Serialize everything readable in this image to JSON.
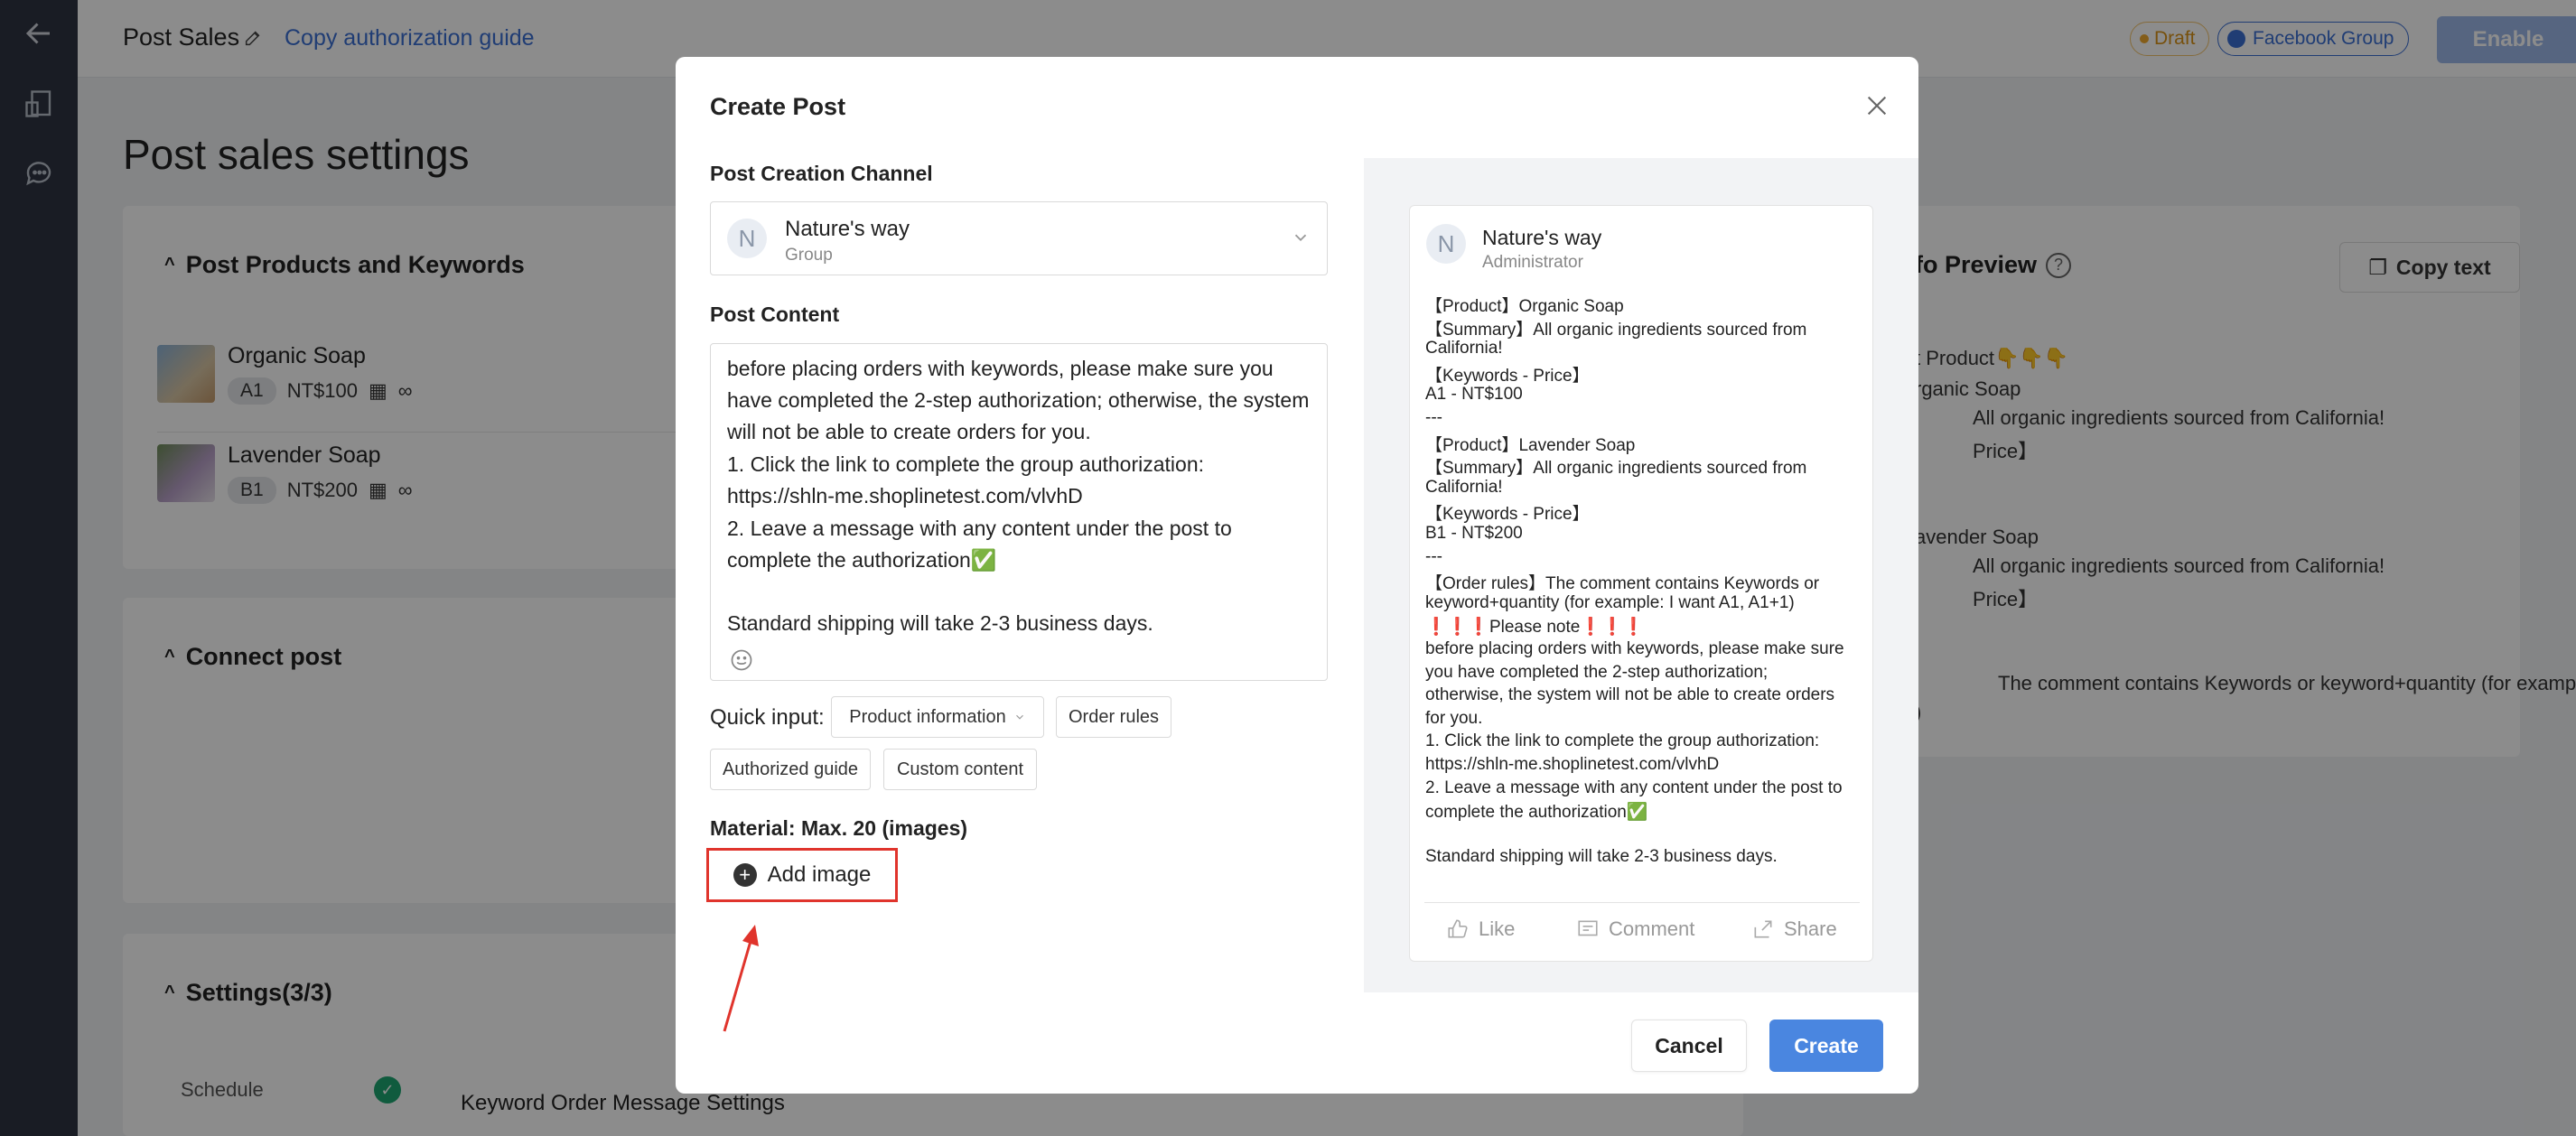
{
  "topbar": {
    "title": "Post Sales",
    "copy_guide_link": "Copy authorization guide",
    "draft_badge": "Draft",
    "channel_badge": "Facebook Group",
    "enable_button": "Enable"
  },
  "background": {
    "page_heading": "Post sales settings",
    "products_section": {
      "title": "Post Products and Keywords",
      "products": [
        {
          "name": "Organic Soap",
          "keyword": "A1",
          "price": "NT$100",
          "stock": "∞"
        },
        {
          "name": "Lavender Soap",
          "keyword": "B1",
          "price": "NT$200",
          "stock": "∞"
        }
      ]
    },
    "connect_section": {
      "title": "Connect post"
    },
    "settings_section": {
      "title": "Settings(3/3)",
      "schedule_tab": "Schedule",
      "keyword_settings": "Keyword Order Message Settings"
    },
    "info_preview": {
      "title_visible": "fo Preview",
      "copy_text_button": "Copy text",
      "lines": [
        "t Product👇👇👇",
        "rganic Soap",
        "All organic ingredients sourced from California!",
        "Price】",
        "avender Soap",
        "All organic ingredients sourced from California!",
        "Price】",
        "The comment contains Keywords or keyword+quantity (for example: I",
        ")"
      ]
    }
  },
  "modal": {
    "title": "Create Post",
    "channel_label": "Post Creation Channel",
    "channel": {
      "avatar_letter": "N",
      "name": "Nature's way",
      "type": "Group"
    },
    "content_label": "Post Content",
    "content_lines": [
      "before placing orders with keywords, please make sure you",
      "have completed the 2-step authorization; otherwise, the system",
      "will not be able to create orders for you.",
      "1. Click the link to complete the group authorization:",
      "https://shln-me.shoplinetest.com/vlvhD",
      "2. Leave a message with any content under the post to",
      "complete the authorization✅",
      "",
      "Standard shipping will take 2-3 business days."
    ],
    "quick_input_label": "Quick input:",
    "quick_buttons": {
      "product_info": "Product information",
      "order_rules": "Order rules",
      "authorized_guide": "Authorized guide",
      "custom_content": "Custom content"
    },
    "material_label": "Material: Max. 20 (images)",
    "add_image": "Add image",
    "cancel": "Cancel",
    "create": "Create",
    "preview": {
      "avatar_letter": "N",
      "name": "Nature's way",
      "role": "Administrator",
      "lines": [
        "【Product】Organic Soap",
        "【Summary】All organic ingredients sourced from",
        "California!",
        "【Keywords - Price】",
        "A1 - NT$100",
        "---",
        "【Product】Lavender Soap",
        "【Summary】All organic ingredients sourced from",
        "California!",
        "【Keywords - Price】",
        "B1 - NT$200",
        "---",
        "【Order rules】The comment contains Keywords or",
        "keyword+quantity (for example: I want A1, A1+1)",
        "❗❗❗Please note❗❗❗",
        "before placing orders with keywords, please make sure",
        "you have completed the 2-step authorization;",
        "otherwise, the system will not be able to create orders",
        "for you.",
        "1. Click the link to complete the group authorization:",
        "https://shln-me.shoplinetest.com/vlvhD",
        "2. Leave a message with any content under the post to",
        "complete the authorization✅",
        "",
        "Standard shipping will take 2-3 business days."
      ],
      "actions": {
        "like": "Like",
        "comment": "Comment",
        "share": "Share"
      }
    }
  },
  "colors": {
    "accent": "#4a86e0",
    "link": "#3b6fd4",
    "annotation_red": "#e0342c",
    "success": "#1ea672",
    "draft": "#f0a92e"
  }
}
